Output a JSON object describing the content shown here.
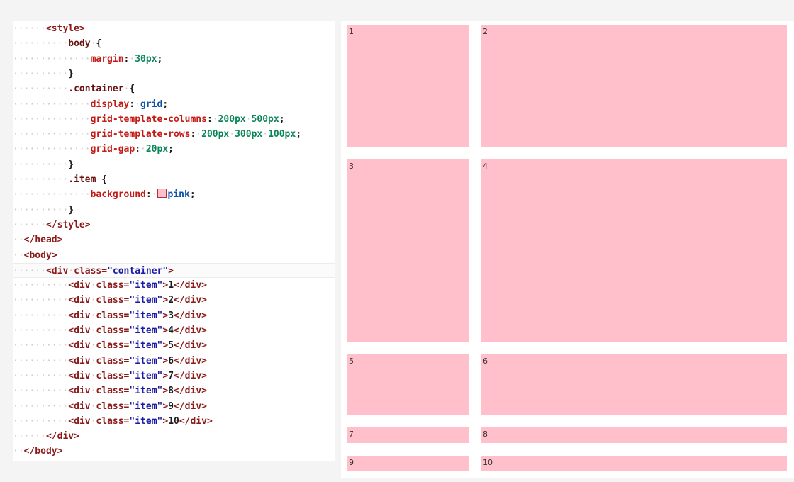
{
  "editor": {
    "lines": [
      [
        {
          "t": "ws",
          "v": "······"
        },
        {
          "t": "tag",
          "v": "<style>"
        }
      ],
      [
        {
          "t": "ws",
          "v": "··········"
        },
        {
          "t": "sel",
          "v": "body"
        },
        {
          "t": "ws",
          "v": "·"
        },
        {
          "t": "punc",
          "v": "{"
        }
      ],
      [
        {
          "t": "ws",
          "v": "··············"
        },
        {
          "t": "prop",
          "v": "margin"
        },
        {
          "t": "punc",
          "v": ":"
        },
        {
          "t": "ws",
          "v": "·"
        },
        {
          "t": "num",
          "v": "30px"
        },
        {
          "t": "punc",
          "v": ";"
        }
      ],
      [
        {
          "t": "ws",
          "v": "··········"
        },
        {
          "t": "punc",
          "v": "}"
        }
      ],
      [
        {
          "t": "ws",
          "v": "··········"
        },
        {
          "t": "sel",
          "v": ".container"
        },
        {
          "t": "ws",
          "v": "·"
        },
        {
          "t": "punc",
          "v": "{"
        }
      ],
      [
        {
          "t": "ws",
          "v": "··············"
        },
        {
          "t": "prop",
          "v": "display"
        },
        {
          "t": "punc",
          "v": ":"
        },
        {
          "t": "ws",
          "v": "·"
        },
        {
          "t": "kw",
          "v": "grid"
        },
        {
          "t": "punc",
          "v": ";"
        }
      ],
      [
        {
          "t": "ws",
          "v": "··············"
        },
        {
          "t": "prop",
          "v": "grid-template-columns"
        },
        {
          "t": "punc",
          "v": ":"
        },
        {
          "t": "ws",
          "v": "·"
        },
        {
          "t": "num",
          "v": "200px"
        },
        {
          "t": "ws",
          "v": "·"
        },
        {
          "t": "num",
          "v": "500px"
        },
        {
          "t": "punc",
          "v": ";"
        }
      ],
      [
        {
          "t": "ws",
          "v": "··············"
        },
        {
          "t": "prop",
          "v": "grid-template-rows"
        },
        {
          "t": "punc",
          "v": ":"
        },
        {
          "t": "ws",
          "v": "·"
        },
        {
          "t": "num",
          "v": "200px"
        },
        {
          "t": "ws",
          "v": "·"
        },
        {
          "t": "num",
          "v": "300px"
        },
        {
          "t": "ws",
          "v": "·"
        },
        {
          "t": "num",
          "v": "100px"
        },
        {
          "t": "punc",
          "v": ";"
        }
      ],
      [
        {
          "t": "ws",
          "v": "··············"
        },
        {
          "t": "prop",
          "v": "grid-gap"
        },
        {
          "t": "punc",
          "v": ":"
        },
        {
          "t": "ws",
          "v": "·"
        },
        {
          "t": "num",
          "v": "20px"
        },
        {
          "t": "punc",
          "v": ";"
        }
      ],
      [
        {
          "t": "ws",
          "v": "··········"
        },
        {
          "t": "punc",
          "v": "}"
        }
      ],
      [
        {
          "t": "ws",
          "v": "··········"
        },
        {
          "t": "sel",
          "v": ".item"
        },
        {
          "t": "ws",
          "v": "·"
        },
        {
          "t": "punc",
          "v": "{"
        }
      ],
      [
        {
          "t": "ws",
          "v": "··············"
        },
        {
          "t": "prop",
          "v": "background"
        },
        {
          "t": "punc",
          "v": ":"
        },
        {
          "t": "ws",
          "v": "·"
        },
        {
          "t": "swatch",
          "v": ""
        },
        {
          "t": "kw",
          "v": "pink"
        },
        {
          "t": "punc",
          "v": ";"
        }
      ],
      [
        {
          "t": "ws",
          "v": "··········"
        },
        {
          "t": "punc",
          "v": "}"
        }
      ],
      [
        {
          "t": "ws",
          "v": "······"
        },
        {
          "t": "tag",
          "v": "</style>"
        }
      ],
      [
        {
          "t": "ws",
          "v": "··"
        },
        {
          "t": "tag",
          "v": "</head>"
        }
      ],
      [
        {
          "t": "ws",
          "v": "··"
        },
        {
          "t": "tag",
          "v": "<body>"
        }
      ],
      [
        {
          "t": "ws",
          "v": "······"
        },
        {
          "t": "tag",
          "v": "<div"
        },
        {
          "t": "ws",
          "v": "·"
        },
        {
          "t": "attr",
          "v": "class="
        },
        {
          "t": "str",
          "v": "\"container\""
        },
        {
          "t": "tag",
          "v": ">"
        },
        {
          "t": "cursor",
          "v": ""
        }
      ],
      [
        {
          "t": "ws",
          "v": "··········"
        },
        {
          "t": "tag",
          "v": "<div"
        },
        {
          "t": "ws",
          "v": "·"
        },
        {
          "t": "attr",
          "v": "class="
        },
        {
          "t": "str",
          "v": "\"item\""
        },
        {
          "t": "tag",
          "v": ">"
        },
        {
          "t": "txt",
          "v": "1"
        },
        {
          "t": "tag",
          "v": "</div>"
        }
      ],
      [
        {
          "t": "ws",
          "v": "··········"
        },
        {
          "t": "tag",
          "v": "<div"
        },
        {
          "t": "ws",
          "v": "·"
        },
        {
          "t": "attr",
          "v": "class="
        },
        {
          "t": "str",
          "v": "\"item\""
        },
        {
          "t": "tag",
          "v": ">"
        },
        {
          "t": "txt",
          "v": "2"
        },
        {
          "t": "tag",
          "v": "</div>"
        }
      ],
      [
        {
          "t": "ws",
          "v": "··········"
        },
        {
          "t": "tag",
          "v": "<div"
        },
        {
          "t": "ws",
          "v": "·"
        },
        {
          "t": "attr",
          "v": "class="
        },
        {
          "t": "str",
          "v": "\"item\""
        },
        {
          "t": "tag",
          "v": ">"
        },
        {
          "t": "txt",
          "v": "3"
        },
        {
          "t": "tag",
          "v": "</div>"
        }
      ],
      [
        {
          "t": "ws",
          "v": "··········"
        },
        {
          "t": "tag",
          "v": "<div"
        },
        {
          "t": "ws",
          "v": "·"
        },
        {
          "t": "attr",
          "v": "class="
        },
        {
          "t": "str",
          "v": "\"item\""
        },
        {
          "t": "tag",
          "v": ">"
        },
        {
          "t": "txt",
          "v": "4"
        },
        {
          "t": "tag",
          "v": "</div>"
        }
      ],
      [
        {
          "t": "ws",
          "v": "··········"
        },
        {
          "t": "tag",
          "v": "<div"
        },
        {
          "t": "ws",
          "v": "·"
        },
        {
          "t": "attr",
          "v": "class="
        },
        {
          "t": "str",
          "v": "\"item\""
        },
        {
          "t": "tag",
          "v": ">"
        },
        {
          "t": "txt",
          "v": "5"
        },
        {
          "t": "tag",
          "v": "</div>"
        }
      ],
      [
        {
          "t": "ws",
          "v": "··········"
        },
        {
          "t": "tag",
          "v": "<div"
        },
        {
          "t": "ws",
          "v": "·"
        },
        {
          "t": "attr",
          "v": "class="
        },
        {
          "t": "str",
          "v": "\"item\""
        },
        {
          "t": "tag",
          "v": ">"
        },
        {
          "t": "txt",
          "v": "6"
        },
        {
          "t": "tag",
          "v": "</div>"
        }
      ],
      [
        {
          "t": "ws",
          "v": "··········"
        },
        {
          "t": "tag",
          "v": "<div"
        },
        {
          "t": "ws",
          "v": "·"
        },
        {
          "t": "attr",
          "v": "class="
        },
        {
          "t": "str",
          "v": "\"item\""
        },
        {
          "t": "tag",
          "v": ">"
        },
        {
          "t": "txt",
          "v": "7"
        },
        {
          "t": "tag",
          "v": "</div>"
        }
      ],
      [
        {
          "t": "ws",
          "v": "··········"
        },
        {
          "t": "tag",
          "v": "<div"
        },
        {
          "t": "ws",
          "v": "·"
        },
        {
          "t": "attr",
          "v": "class="
        },
        {
          "t": "str",
          "v": "\"item\""
        },
        {
          "t": "tag",
          "v": ">"
        },
        {
          "t": "txt",
          "v": "8"
        },
        {
          "t": "tag",
          "v": "</div>"
        }
      ],
      [
        {
          "t": "ws",
          "v": "··········"
        },
        {
          "t": "tag",
          "v": "<div"
        },
        {
          "t": "ws",
          "v": "·"
        },
        {
          "t": "attr",
          "v": "class="
        },
        {
          "t": "str",
          "v": "\"item\""
        },
        {
          "t": "tag",
          "v": ">"
        },
        {
          "t": "txt",
          "v": "9"
        },
        {
          "t": "tag",
          "v": "</div>"
        }
      ],
      [
        {
          "t": "ws",
          "v": "··········"
        },
        {
          "t": "tag",
          "v": "<div"
        },
        {
          "t": "ws",
          "v": "·"
        },
        {
          "t": "attr",
          "v": "class="
        },
        {
          "t": "str",
          "v": "\"item\""
        },
        {
          "t": "tag",
          "v": ">"
        },
        {
          "t": "txt",
          "v": "10"
        },
        {
          "t": "tag",
          "v": "</div>"
        }
      ],
      [
        {
          "t": "ws",
          "v": "······"
        },
        {
          "t": "tag",
          "v": "</div>"
        }
      ],
      [
        {
          "t": "ws",
          "v": "··"
        },
        {
          "t": "tag",
          "v": "</body>"
        }
      ]
    ]
  },
  "preview": {
    "items": [
      "1",
      "2",
      "3",
      "4",
      "5",
      "6",
      "7",
      "8",
      "9",
      "10"
    ],
    "item_color": "#ffc0cb"
  },
  "colors": {
    "tag": "#8b1a1a",
    "string": "#1a1aa6",
    "property": "#c41a16",
    "number": "#098658",
    "keyword": "#0f52a8"
  }
}
